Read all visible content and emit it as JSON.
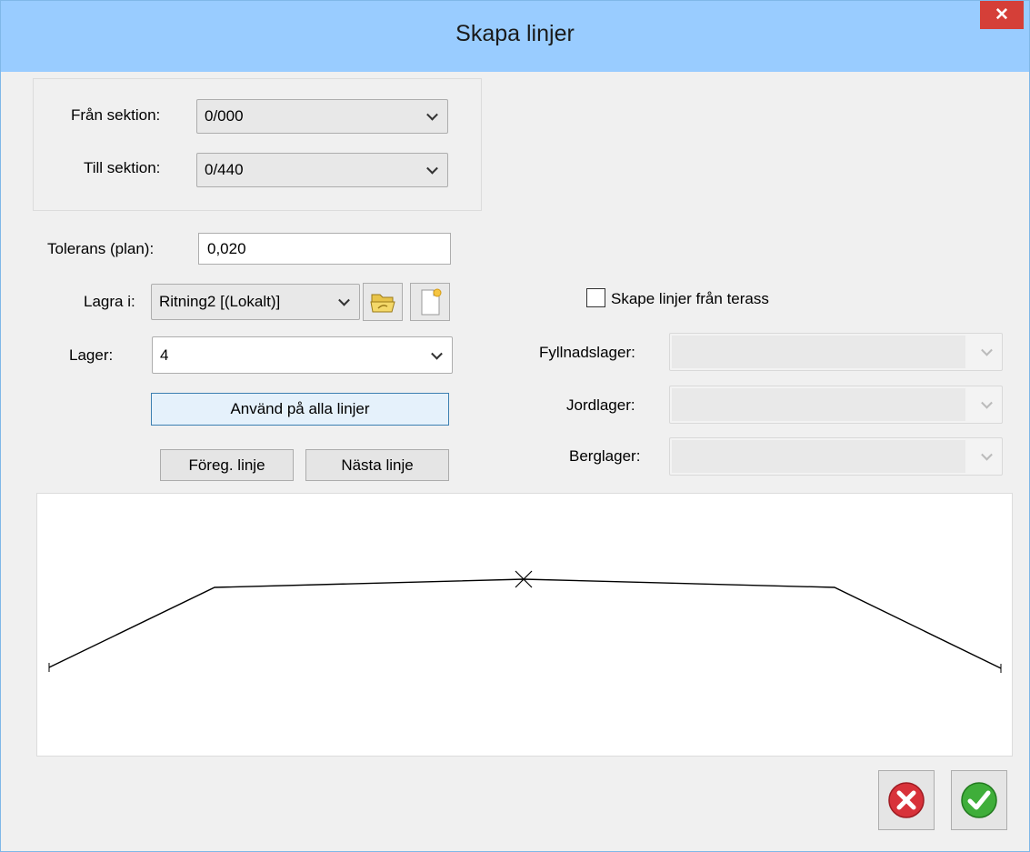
{
  "window": {
    "title": "Skapa linjer",
    "close_glyph": "✕"
  },
  "sections": {
    "from_label": "Från sektion:",
    "from_value": "0/000",
    "to_label": "Till sektion:",
    "to_value": "0/440"
  },
  "tolerance": {
    "label": "Tolerans (plan):",
    "value": "0,020"
  },
  "store": {
    "label": "Lagra i:",
    "value": "Ritning2 [(Lokalt)]",
    "open_icon": "folder-open-icon",
    "new_icon": "new-document-icon"
  },
  "layer": {
    "label": "Lager:",
    "value": "4"
  },
  "buttons": {
    "apply_all": "Använd på alla linjer",
    "prev": "Föreg. linje",
    "next": "Nästa linje",
    "cancel_icon": "cancel-icon",
    "ok_icon": "ok-checkmark-icon"
  },
  "terrace": {
    "checkbox_label": "Skape linjer från terass",
    "checked": false,
    "fill_label": "Fyllnadslager:",
    "soil_label": "Jordlager:",
    "rock_label": "Berglager:"
  },
  "colors": {
    "titlebar": "#99ccff",
    "close": "#d53f38",
    "cancel": "#d8323a",
    "ok": "#3fae3a"
  }
}
